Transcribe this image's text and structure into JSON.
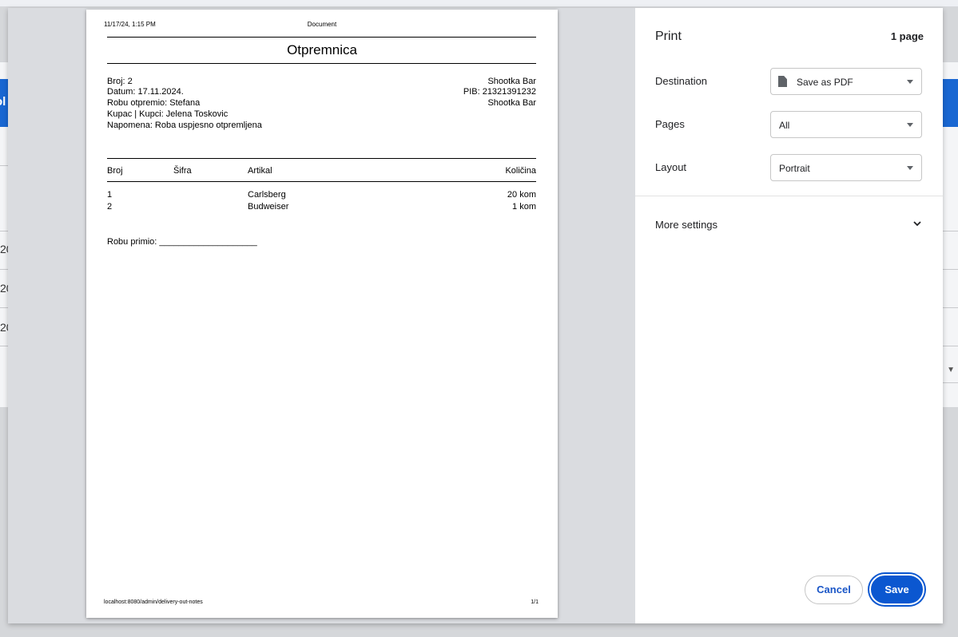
{
  "background": {
    "partial_button_text": "ol",
    "row_values": [
      "20",
      "20",
      "20"
    ]
  },
  "document": {
    "header_datetime": "11/17/24, 1:15 PM",
    "header_title": "Document",
    "title": "Otpremnica",
    "left_info": [
      "Broj: 2",
      "Datum: 17.11.2024.",
      "Robu otpremio: Stefana",
      "Kupac | Kupci: Jelena Toskovic",
      "Napomena: Roba uspjesno otpremljena"
    ],
    "right_info": [
      "Shootka Bar",
      "PIB: 21321391232",
      "Shootka Bar"
    ],
    "table": {
      "headers": [
        "Broj",
        "Šifra",
        "Artikal",
        "Količina"
      ],
      "rows": [
        {
          "broj": "1",
          "sifra": "",
          "artikal": "Carlsberg",
          "kolicina": "20 kom"
        },
        {
          "broj": "2",
          "sifra": "",
          "artikal": "Budweiser",
          "kolicina": "1 kom"
        }
      ]
    },
    "received_by": "Robu primio: ____________________",
    "footer_url": "localhost:8080/admin/delivery-out-notes",
    "footer_page": "1/1"
  },
  "print": {
    "title": "Print",
    "page_count": "1 page",
    "destination_label": "Destination",
    "destination_value": "Save as PDF",
    "destination_icon": "file-icon",
    "pages_label": "Pages",
    "pages_value": "All",
    "layout_label": "Layout",
    "layout_value": "Portrait",
    "more_settings": "More settings",
    "cancel": "Cancel",
    "save": "Save",
    "accent_color": "#0b57d0"
  }
}
